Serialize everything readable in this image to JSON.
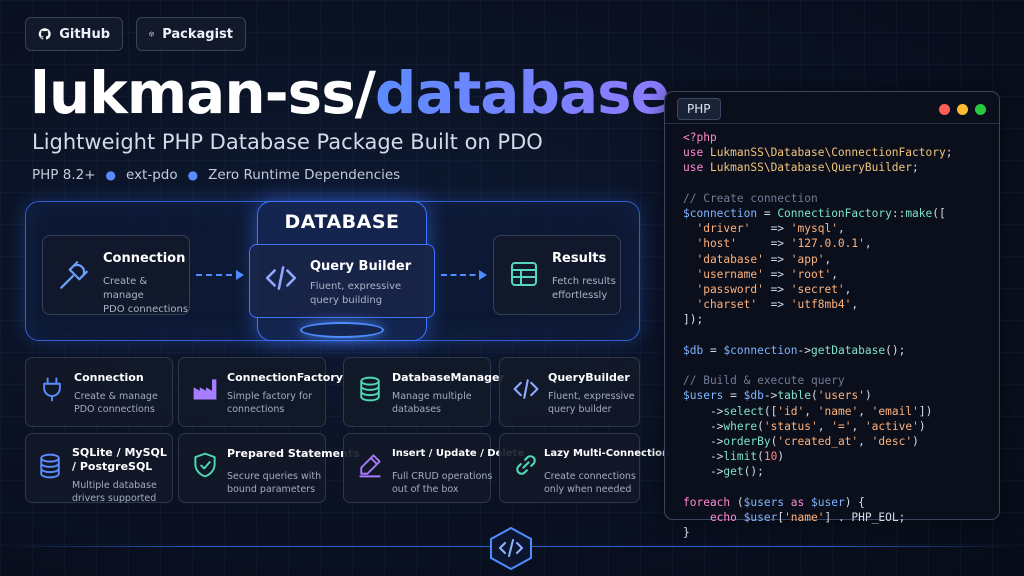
{
  "links": {
    "github": "GitHub",
    "packagist": "Packagist"
  },
  "title": {
    "part1": "lukman-ss/",
    "part2": "database"
  },
  "subtitle": "Lightweight PHP Database Package Built on PDO",
  "requirements": [
    "PHP 8.2+",
    "ext-pdo",
    "Zero Runtime Dependencies"
  ],
  "diagram": {
    "label": "DATABASE",
    "steps": [
      {
        "title": "Connection",
        "desc1": "Create & manage",
        "desc2": "PDO connections",
        "icon": "plug-icon"
      },
      {
        "title": "Query Builder",
        "desc1": "Fluent, expressive",
        "desc2": "query building",
        "icon": "code-icon"
      },
      {
        "title": "Results",
        "desc1": "Fetch results",
        "desc2": "effortlessly",
        "icon": "table-icon"
      }
    ]
  },
  "features": [
    {
      "title": "Connection",
      "desc1": "Create & manage",
      "desc2": "PDO connections",
      "icon": "plug-icon"
    },
    {
      "title": "ConnectionFactory",
      "desc1": "Simple factory for",
      "desc2": "connections",
      "icon": "factory-icon"
    },
    {
      "title": "DatabaseManager",
      "desc1": "Manage multiple",
      "desc2": "databases",
      "icon": "database-icon"
    },
    {
      "title": "QueryBuilder",
      "desc1": "Fluent, expressive",
      "desc2": "query builder",
      "icon": "code-icon"
    },
    {
      "title": "SQLite / MySQL / PostgreSQL",
      "desc1": "Multiple database",
      "desc2": "drivers supported",
      "icon": "database-icon"
    },
    {
      "title": "Prepared Statements",
      "desc1": "Secure queries with",
      "desc2": "bound parameters",
      "icon": "shield-check-icon"
    },
    {
      "title": "Insert / Update / Delete",
      "desc1": "Full CRUD operations",
      "desc2": "out of the box",
      "icon": "pencil-icon"
    },
    {
      "title": "Lazy Multi-Connection",
      "desc1": "Create connections",
      "desc2": "only when needed",
      "icon": "link-icon"
    }
  ],
  "code_panel": {
    "language": "PHP",
    "lines": [
      [
        [
          "c-kw",
          "<?php"
        ]
      ],
      [
        [
          "c-kw",
          "use "
        ],
        [
          "c-ns",
          "LukmanSS\\Database\\ConnectionFactory"
        ],
        [
          "c-pl",
          ";"
        ]
      ],
      [
        [
          "c-kw",
          "use "
        ],
        [
          "c-ns",
          "LukmanSS\\Database\\QueryBuilder"
        ],
        [
          "c-pl",
          ";"
        ]
      ],
      [],
      [
        [
          "c-cm",
          "// Create connection"
        ]
      ],
      [
        [
          "c-var",
          "$connection"
        ],
        [
          "c-pl",
          " = "
        ],
        [
          "c-fn",
          "ConnectionFactory"
        ],
        [
          "c-pl",
          "::"
        ],
        [
          "c-fn",
          "make"
        ],
        [
          "c-pl",
          "(["
        ]
      ],
      [
        [
          "c-str",
          "  'driver'"
        ],
        [
          "c-pl",
          "   => "
        ],
        [
          "c-str",
          "'mysql'"
        ],
        [
          "c-pl",
          ","
        ]
      ],
      [
        [
          "c-str",
          "  'host'"
        ],
        [
          "c-pl",
          "     => "
        ],
        [
          "c-str",
          "'127.0.0.1'"
        ],
        [
          "c-pl",
          ","
        ]
      ],
      [
        [
          "c-str",
          "  'database'"
        ],
        [
          "c-pl",
          " => "
        ],
        [
          "c-str",
          "'app'"
        ],
        [
          "c-pl",
          ","
        ]
      ],
      [
        [
          "c-str",
          "  'username'"
        ],
        [
          "c-pl",
          " => "
        ],
        [
          "c-str",
          "'root'"
        ],
        [
          "c-pl",
          ","
        ]
      ],
      [
        [
          "c-str",
          "  'password'"
        ],
        [
          "c-pl",
          " => "
        ],
        [
          "c-str",
          "'secret'"
        ],
        [
          "c-pl",
          ","
        ]
      ],
      [
        [
          "c-str",
          "  'charset'"
        ],
        [
          "c-pl",
          "  => "
        ],
        [
          "c-str",
          "'utf8mb4'"
        ],
        [
          "c-pl",
          ","
        ]
      ],
      [
        [
          "c-pl",
          "]);"
        ]
      ],
      [],
      [
        [
          "c-var",
          "$db"
        ],
        [
          "c-pl",
          " = "
        ],
        [
          "c-var",
          "$connection"
        ],
        [
          "c-pl",
          "->"
        ],
        [
          "c-fn",
          "getDatabase"
        ],
        [
          "c-pl",
          "();"
        ]
      ],
      [],
      [
        [
          "c-cm",
          "// Build & execute query"
        ]
      ],
      [
        [
          "c-var",
          "$users"
        ],
        [
          "c-pl",
          " = "
        ],
        [
          "c-var",
          "$db"
        ],
        [
          "c-pl",
          "->"
        ],
        [
          "c-fn",
          "table"
        ],
        [
          "c-pl",
          "("
        ],
        [
          "c-str",
          "'users'"
        ],
        [
          "c-pl",
          ")"
        ]
      ],
      [
        [
          "c-pl",
          "    ->"
        ],
        [
          "c-fn",
          "select"
        ],
        [
          "c-pl",
          "(["
        ],
        [
          "c-str",
          "'id'"
        ],
        [
          "c-pl",
          ", "
        ],
        [
          "c-str",
          "'name'"
        ],
        [
          "c-pl",
          ", "
        ],
        [
          "c-str",
          "'email'"
        ],
        [
          "c-pl",
          "])"
        ]
      ],
      [
        [
          "c-pl",
          "    ->"
        ],
        [
          "c-fn",
          "where"
        ],
        [
          "c-pl",
          "("
        ],
        [
          "c-str",
          "'status'"
        ],
        [
          "c-pl",
          ", "
        ],
        [
          "c-str",
          "'='"
        ],
        [
          "c-pl",
          ", "
        ],
        [
          "c-str",
          "'active'"
        ],
        [
          "c-pl",
          ")"
        ]
      ],
      [
        [
          "c-pl",
          "    ->"
        ],
        [
          "c-fn",
          "orderBy"
        ],
        [
          "c-pl",
          "("
        ],
        [
          "c-str",
          "'created_at'"
        ],
        [
          "c-pl",
          ", "
        ],
        [
          "c-str",
          "'desc'"
        ],
        [
          "c-pl",
          ")"
        ]
      ],
      [
        [
          "c-pl",
          "    ->"
        ],
        [
          "c-fn",
          "limit"
        ],
        [
          "c-pl",
          "("
        ],
        [
          "c-num",
          "10"
        ],
        [
          "c-pl",
          ")"
        ]
      ],
      [
        [
          "c-pl",
          "    ->"
        ],
        [
          "c-fn",
          "get"
        ],
        [
          "c-pl",
          "();"
        ]
      ],
      [],
      [
        [
          "c-kw",
          "foreach"
        ],
        [
          "c-pl",
          " ("
        ],
        [
          "c-var",
          "$users"
        ],
        [
          "c-kw",
          " as "
        ],
        [
          "c-var",
          "$user"
        ],
        [
          "c-pl",
          ") {"
        ]
      ],
      [
        [
          "c-kw",
          "    echo "
        ],
        [
          "c-var",
          "$user"
        ],
        [
          "c-pl",
          "["
        ],
        [
          "c-str",
          "'name'"
        ],
        [
          "c-pl",
          "] . PHP_EOL;"
        ]
      ],
      [
        [
          "c-pl",
          "}"
        ]
      ]
    ]
  },
  "colors": {
    "accent": "#4d8dff",
    "title_gradient_start": "#5b8cff",
    "title_gradient_end": "#8f7bff",
    "dot_red": "#ff5f57",
    "dot_yellow": "#febc2e",
    "dot_green": "#28c840"
  }
}
